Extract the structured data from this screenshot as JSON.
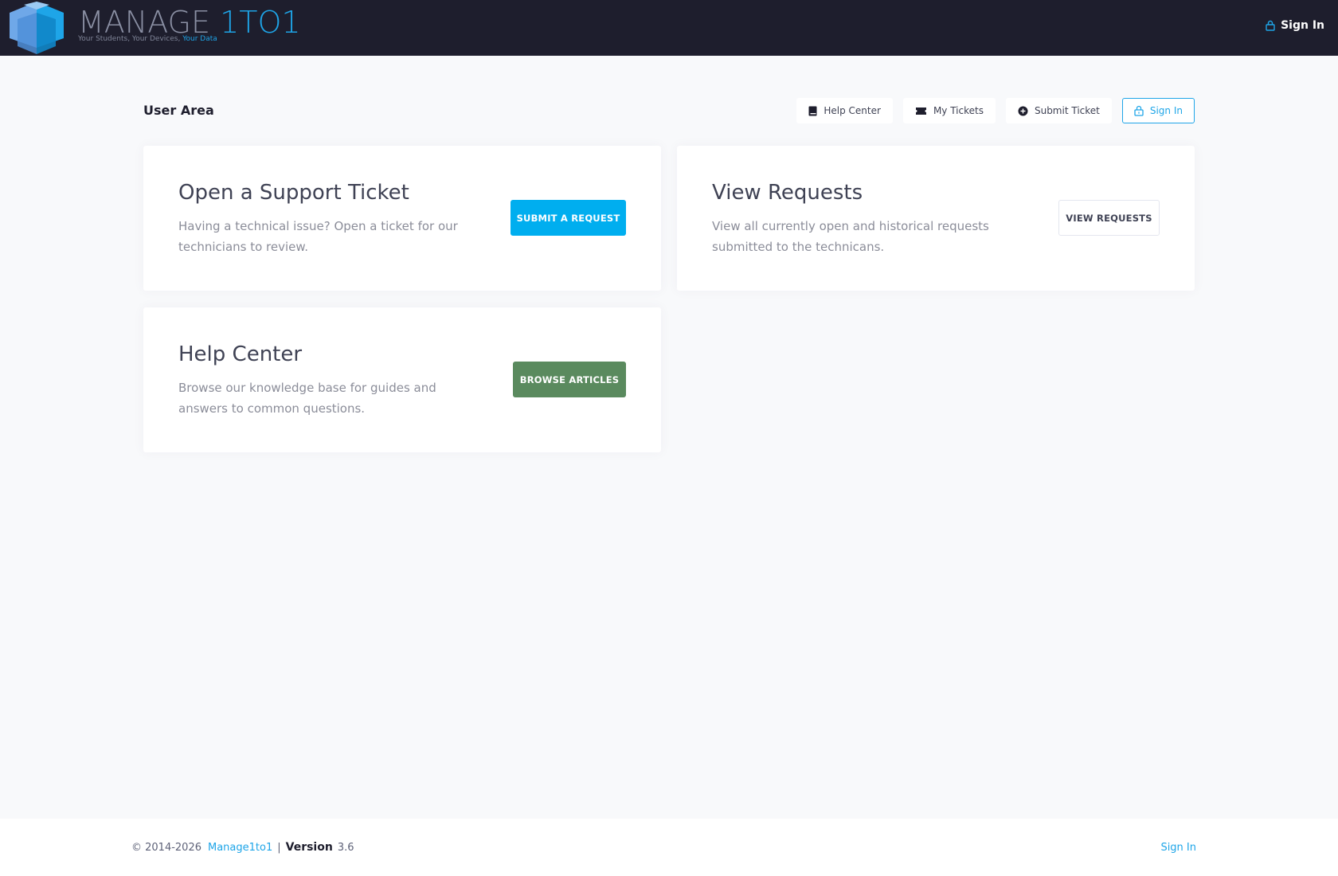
{
  "header": {
    "logo_text_main": "MANAGE ",
    "logo_text_accent": "1TO1",
    "logo_tagline_main": "Your Students, Your Devices, ",
    "logo_tagline_accent": "Your Data",
    "signin_label": "Sign In"
  },
  "page": {
    "title": "User Area"
  },
  "toolbar": {
    "help_center": "Help Center",
    "my_tickets": "My Tickets",
    "submit_ticket": "Submit Ticket",
    "sign_in": "Sign In"
  },
  "cards": [
    {
      "title": "Open a Support Ticket",
      "description": "Having a technical issue? Open a ticket for our technicians to review.",
      "button": "SUBMIT A REQUEST"
    },
    {
      "title": "View Requests",
      "description": "View all currently open and historical requests submitted to the technicans.",
      "button": "VIEW REQUESTS"
    },
    {
      "title": "Help Center",
      "description": "Browse our knowledge base for guides and answers to common questions.",
      "button": "BROWSE ARTICLES"
    }
  ],
  "footer": {
    "copyright": "© 2014-2026",
    "company_link": "Manage1to1",
    "separator": "|",
    "version_label": "Version",
    "version_value": "3.6",
    "signin_link": "Sign In"
  },
  "colors": {
    "header_bg": "#1e1e2d",
    "accent_blue": "#00aeef",
    "browse_green": "#5a8a5e",
    "page_bg": "#f8f9fb"
  },
  "icons": {
    "top_signin": "lock-icon",
    "help_center": "book-icon",
    "my_tickets": "ticket-icon",
    "submit_ticket": "plus-circle-icon",
    "sign_in": "lock-icon"
  }
}
